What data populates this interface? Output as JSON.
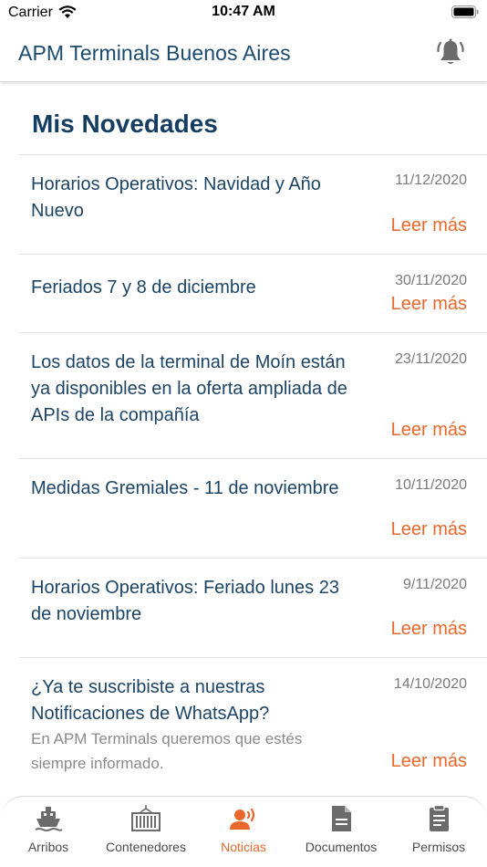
{
  "status_bar": {
    "carrier": "Carrier",
    "time": "10:47 AM"
  },
  "header": {
    "title": "APM Terminals Buenos Aires",
    "icon": "bell-alert-icon"
  },
  "section_title": "Mis Novedades",
  "news": [
    {
      "title": "Horarios Operativos: Navidad y Año Nuevo",
      "date": "11/12/2020",
      "more": "Leer más"
    },
    {
      "title": "Feriados 7 y 8 de diciembre",
      "date": "30/11/2020",
      "more": "Leer más"
    },
    {
      "title": "Los datos de la terminal de Moín están ya disponibles en la oferta ampliada de APIs de la compañía",
      "date": "23/11/2020",
      "more": "Leer más"
    },
    {
      "title": "Medidas Gremiales - 11 de noviembre",
      "date": "10/11/2020",
      "more": "Leer más"
    },
    {
      "title": "Horarios Operativos: Feriado lunes 23 de noviembre",
      "date": "9/11/2020",
      "more": "Leer más"
    },
    {
      "title": "¿Ya te suscribiste a nuestras Notificaciones de WhatsApp?",
      "summary": "En APM Terminals queremos que estés siempre informado.",
      "date": "14/10/2020",
      "more": "Leer más"
    }
  ],
  "tabs": [
    {
      "label": "Arribos",
      "icon": "ship-icon"
    },
    {
      "label": "Contenedores",
      "icon": "container-icon"
    },
    {
      "label": "Noticias",
      "icon": "broadcast-user-icon",
      "active": true
    },
    {
      "label": "Documentos",
      "icon": "document-icon"
    },
    {
      "label": "Permisos",
      "icon": "clipboard-icon"
    }
  ],
  "colors": {
    "primary": "#153d62",
    "accent": "#e8672a",
    "muted": "#7a7a7a",
    "icon": "#6b6b6b"
  }
}
